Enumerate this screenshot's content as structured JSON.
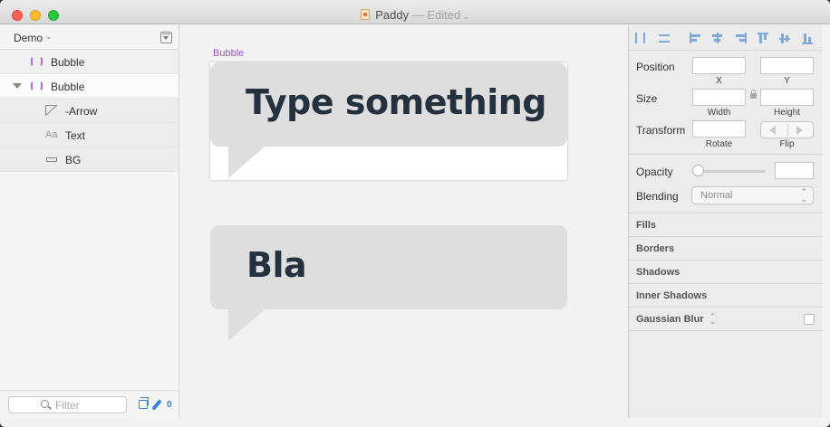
{
  "window": {
    "title": "Paddy",
    "edited": "— Edited",
    "dropdown": "⌄"
  },
  "sidebar": {
    "page": "Demo",
    "layers": [
      {
        "name": "Bubble",
        "icon": "symbol-icon"
      },
      {
        "name": "Bubble",
        "icon": "symbol-icon",
        "expanded": true
      },
      {
        "name": "-Arrow",
        "icon": "shape-icon"
      },
      {
        "name": "Text",
        "icon": "text-icon",
        "glyph": "Aa"
      },
      {
        "name": "BG",
        "icon": "rectangle-icon"
      }
    ],
    "filter_placeholder": "Filter",
    "count": "0"
  },
  "canvas": {
    "artboard_label": "Bubble",
    "bubble1_text": "Type something",
    "bubble2_text": "Bla",
    "bubble_color": "#dedede",
    "text_color": "#24323f"
  },
  "inspector": {
    "position_label": "Position",
    "x_label": "X",
    "y_label": "Y",
    "size_label": "Size",
    "width_label": "Width",
    "height_label": "Height",
    "transform_label": "Transform",
    "rotate_label": "Rotate",
    "flip_label": "Flip",
    "opacity_label": "Opacity",
    "opacity_value": 0,
    "blending_label": "Blending",
    "blending_value": "Normal",
    "sections": [
      "Fills",
      "Borders",
      "Shadows",
      "Inner Shadows",
      "Gaussian Blur"
    ]
  }
}
